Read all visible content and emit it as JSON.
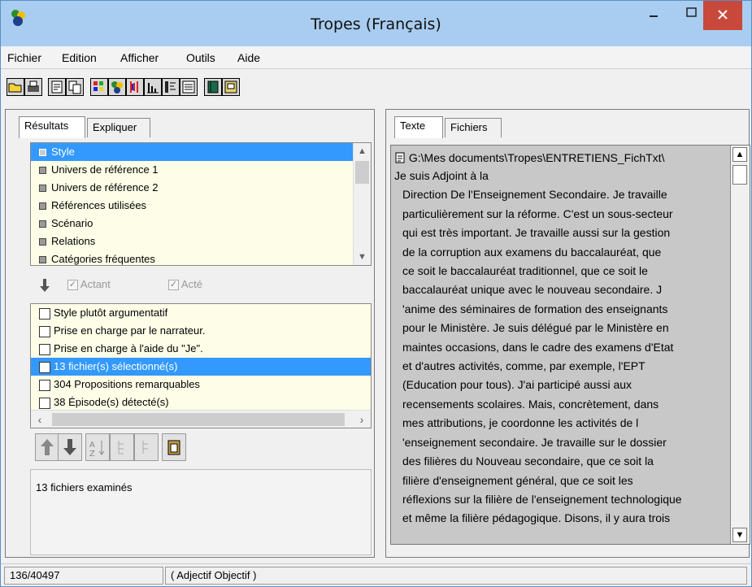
{
  "window": {
    "title": "Tropes (Français)"
  },
  "menu": [
    "Fichier",
    "Edition",
    "Afficher",
    "Outils",
    "Aide"
  ],
  "toolbar": {
    "icons": [
      "open-folder-icon",
      "print-icon",
      "properties-icon",
      "copy-icon",
      "grid-icon",
      "people-icon",
      "bars-red-icon",
      "bar-chart-icon",
      "tree-icon",
      "list-icon",
      "book-icon",
      "save-icon"
    ]
  },
  "left_panel": {
    "tabs": [
      "Résultats",
      "Expliquer"
    ],
    "categories": [
      "Style",
      "Univers de référence 1",
      "Univers de référence 2",
      "Références utilisées",
      "Scénario",
      "Relations",
      "Catégories fréquentes"
    ],
    "actant_label": "Actant",
    "acte_label": "Acté",
    "items": [
      "Style plutôt argumentatif",
      "Prise en charge par le narrateur.",
      "Prise en charge à l'aide du \"Je\".",
      "13 fichier(s) sélectionné(s)",
      "304 Propositions remarquables",
      "38 Épisode(s) détecté(s)"
    ],
    "examined_text": "13  fichiers examinés"
  },
  "right_panel": {
    "tabs": [
      "Texte",
      "Fichiers"
    ],
    "path": "G:\\Mes documents\\Tropes\\ENTRETIENS_FichTxt\\",
    "lines": [
      "Je suis Adjoint à la",
      "Direction De l'Enseignement Secondaire. Je travaille",
      "particulièrement sur la réforme. C'est un sous-secteur",
      "qui est très important. Je travaille aussi sur la gestion",
      "de la corruption aux examens du baccalauréat,  que",
      "ce soit le baccalauréat traditionnel,  que ce soit le",
      "baccalauréat unique avec le nouveau secondaire. J",
      "'anime des séminaires de formation des enseignants",
      "pour le Ministère. Je suis délégué par le Ministère en",
      "maintes occasions, dans le cadre des examens d'Etat",
      "et d'autres activités,  comme, par exemple, l'EPT",
      "(Education pour tous). J'ai participé aussi aux",
      "recensements scolaires. Mais, concrètement, dans",
      "mes attributions,  je coordonne les activités de l",
      "'enseignement secondaire. Je travaille sur le dossier",
      "des filières du Nouveau secondaire,  que ce soit la",
      "filière d'enseignement général,  que ce soit les",
      "réflexions sur la filière de l'enseignement technologique",
      "et même la filière pédagogique. Disons, il y aura trois"
    ]
  },
  "status": {
    "position": "136/40497",
    "category": "( Adjectif Objectif )"
  }
}
